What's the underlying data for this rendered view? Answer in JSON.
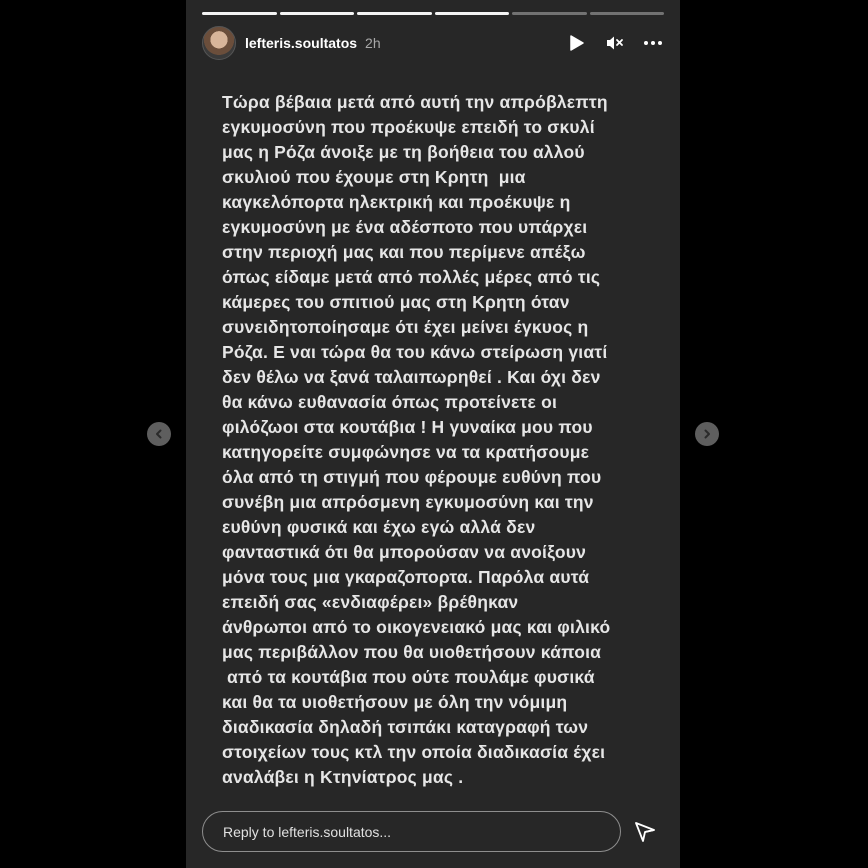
{
  "story": {
    "username": "lefteris.soultatos",
    "timestamp": "2h",
    "progress_segments": [
      {
        "state": "done"
      },
      {
        "state": "done"
      },
      {
        "state": "done"
      },
      {
        "state": "done"
      },
      {
        "state": "pending"
      },
      {
        "state": "pending"
      }
    ],
    "text_lines": [
      "Τώρα βέβαια μετά από αυτή την απρόβλεπτη",
      "εγκυμοσύνη που προέκυψε επειδή το σκυλί",
      "μας η Ρόζα άνοιξε με τη βοήθεια του αλλού",
      "σκυλιού που έχουμε στη Κρητη  μια",
      "καγκελόπορτα ηλεκτρική και προέκυψε η",
      "εγκυμοσύνη με ένα αδέσποτο που υπάρχει",
      "στην περιοχή μας και που περίμενε απέξω",
      "όπως είδαμε μετά από πολλές μέρες από τις",
      "κάμερες του σπιτιού μας στη Κρητη όταν",
      "συνειδητοποίησαμε ότι έχει μείνει έγκυος η",
      "Ρόζα. Ε ναι τώρα θα του κάνω στείρωση γιατί",
      "δεν θέλω να ξανά ταλαιπωρηθεί . Και όχι δεν",
      "θα κάνω ευθανασία όπως προτείνετε οι",
      "φιλόζωοι στα κουτάβια ! Η γυναίκα μου που",
      "κατηγορείτε συμφώνησε να τα κρατήσουμε",
      "όλα από τη στιγμή που φέρουμε ευθύνη που",
      "συνέβη μια απρόσμενη εγκυμοσύνη και την",
      "ευθύνη φυσικά και έχω εγώ αλλά δεν",
      "φανταστικά ότι θα μπορούσαν να ανοίξουν",
      "μόνα τους μια γκαραζοπορτα. Παρόλα αυτά",
      "επειδή σας «ενδιαφέρει» βρέθηκαν",
      "άνθρωποι από το οικογενειακό μας και φιλικό",
      "μας περιβάλλον που θα υιοθετήσουν κάποια",
      " από τα κουτάβια που ούτε πουλάμε φυσικά",
      "και θα τα υιοθετήσουν με όλη την νόμιμη",
      "διαδικασία δηλαδή τσιπάκι καταγραφή των",
      "στοιχείων τους κτλ την οποία διαδικασία έχει",
      "αναλάβει η Κτηνίατρος μας ."
    ],
    "reply_placeholder": "Reply to lefteris.soultatos...",
    "icons": {
      "play": "play-icon",
      "mute": "mute-icon",
      "more": "more-icon",
      "send": "send-icon",
      "prev": "chevron-left-icon",
      "next": "chevron-right-icon"
    },
    "colors": {
      "background": "#000000",
      "panel": "#272727",
      "text": "#e6e6e6"
    }
  }
}
